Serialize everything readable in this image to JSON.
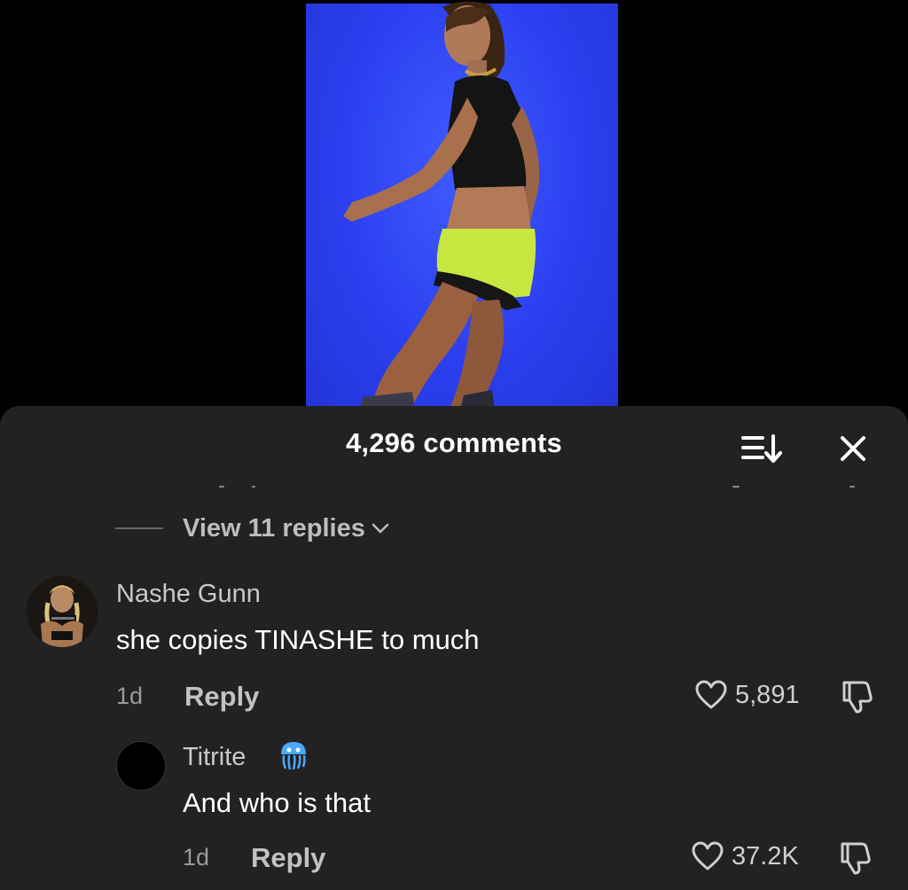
{
  "sheet": {
    "title": "4,296 comments"
  },
  "thread": {
    "view_replies": "View 11 replies"
  },
  "comments": [
    {
      "username": "Nashe Gunn",
      "text": "she copies TINASHE to much",
      "time": "1d",
      "reply_label": "Reply",
      "likes": "5,891"
    },
    {
      "username": "Titrite",
      "text": "And who is that",
      "time": "1d",
      "reply_label": "Reply",
      "likes": "37.2K",
      "badge_icon": "jellyfish-icon"
    }
  ],
  "colors": {
    "sheet_bg": "#222222",
    "video_bg": "#2c3ff0",
    "badge": "#4aa8ff"
  }
}
